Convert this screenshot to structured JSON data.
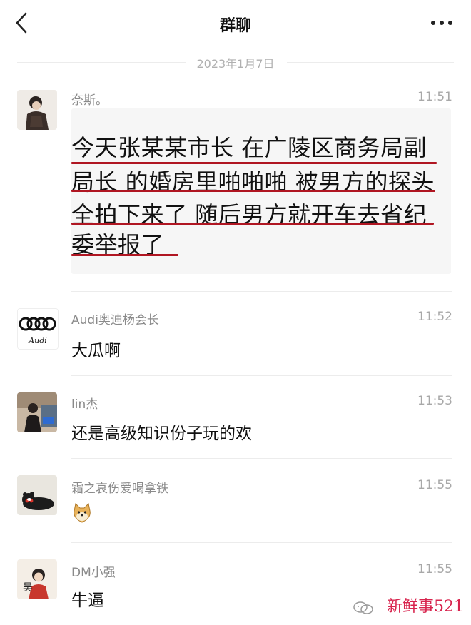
{
  "header": {
    "title": "群聊",
    "back_icon": "chevron-left-icon",
    "more_icon": "more-dots-icon"
  },
  "date_separator": "2023年1月7日",
  "messages": [
    {
      "sender": "奈斯。",
      "time": "11:51",
      "kind": "screenshot-quote",
      "quote_lines": [
        "今天张某某市长 在广陵区商务局副",
        "局长 的婚房里啪啪啪 被男方的探头",
        "全拍下来了 随后男方就开车去省纪",
        "委举报了"
      ],
      "underline_color": "#b01622"
    },
    {
      "sender": "Audi奥迪杨会长",
      "time": "11:52",
      "text": "大瓜啊",
      "avatar_text": "Audi"
    },
    {
      "sender": "lin杰",
      "time": "11:53",
      "text": "还是高级知识份子玩的欢"
    },
    {
      "sender": "霜之哀伤爱喝拿铁",
      "time": "11:55",
      "text": "",
      "emoji": "doge-emoji-icon"
    },
    {
      "sender": "DM小强",
      "time": "11:55",
      "text": "牛逼",
      "avatar_text": "吴"
    }
  ],
  "watermark": {
    "text": "新鲜事521",
    "icon": "wechat-channel-icon"
  },
  "colors": {
    "divider": "#ececec",
    "muted": "#8a8a8a",
    "accent_red": "#b01622",
    "watermark": "#d8244e"
  }
}
